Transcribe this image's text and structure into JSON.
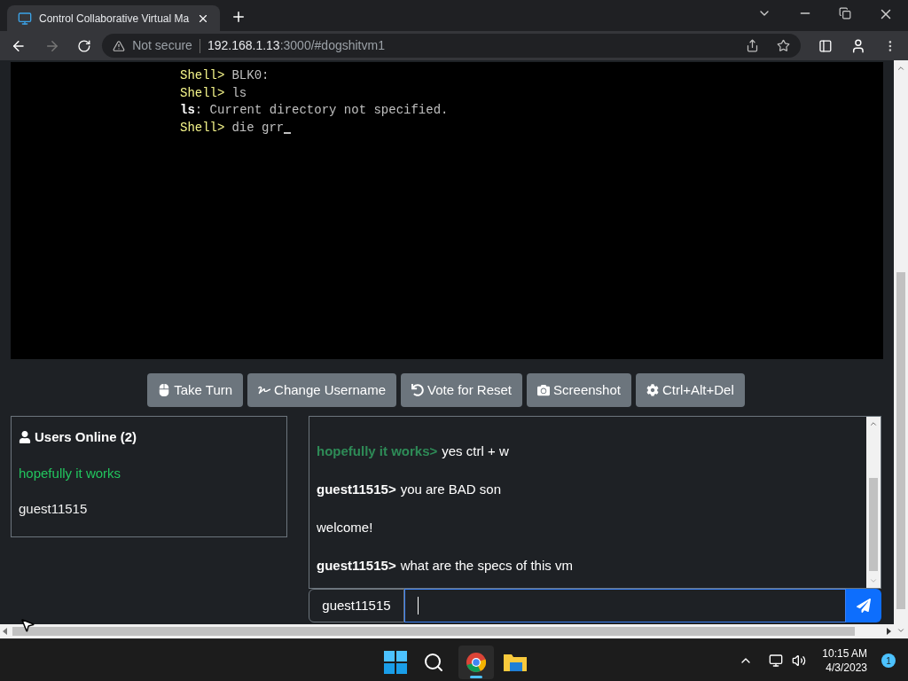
{
  "browser": {
    "tab": {
      "title": "Control Collaborative Virtual Ma",
      "selected": true
    },
    "security": "Not secure",
    "url_host": "192.168.1.13",
    "url_rest": ":3000/#dogshitvm1"
  },
  "terminal": {
    "lines": [
      {
        "kind": "prompt",
        "prompt": "Shell>",
        "text": "BLK0:"
      },
      {
        "kind": "prompt",
        "prompt": "Shell>",
        "text": "ls"
      },
      {
        "kind": "output",
        "text": "**ls**: Current directory not specified."
      },
      {
        "kind": "prompt",
        "prompt": "Shell>",
        "text": "die grr"
      }
    ]
  },
  "buttons": [
    "Take Turn",
    "Change Username",
    "Vote for Reset",
    "Screenshot",
    "Ctrl+Alt+Del"
  ],
  "users": {
    "title": "Users Online (2)",
    "items": [
      {
        "name": "hopefully it works",
        "color": "#22c55e"
      },
      {
        "name": "guest11515",
        "color": "#f1f1f1"
      }
    ]
  },
  "chat": {
    "messages": [
      {
        "kind": "user",
        "user": "hopefully it works>",
        "color": "#2e8b57",
        "text": "yes ctrl + w"
      },
      {
        "kind": "user",
        "user": "guest11515>",
        "color": "#ffffff",
        "text": "you are BAD son"
      },
      {
        "kind": "system",
        "text": "welcome!"
      },
      {
        "kind": "user",
        "user": "guest11515>",
        "color": "#ffffff",
        "text": "what are the specs of this vm"
      }
    ],
    "username": "guest11515"
  },
  "taskbar": {
    "time": "10:15 AM",
    "date": "4/3/2023",
    "notifications": "1"
  }
}
